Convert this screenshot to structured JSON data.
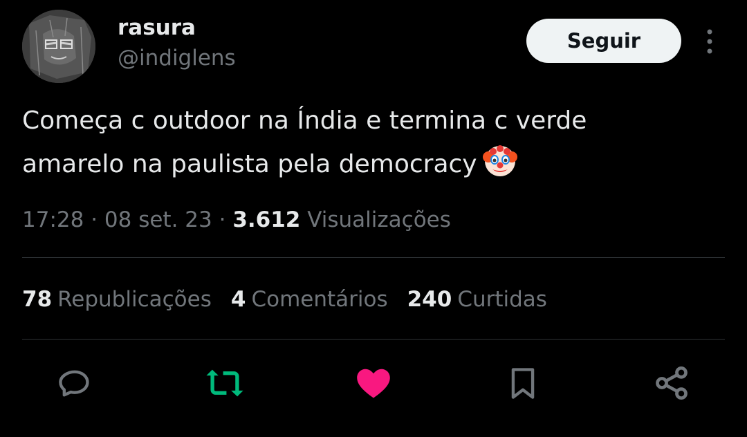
{
  "user": {
    "name": "rasura",
    "handle": "@indiglens",
    "follow_label": "Seguir"
  },
  "tweet": {
    "line1": "Começa c outdoor na Índia e termina c verde",
    "line2": "amarelo na paulista pela democracy",
    "emoji": "clown-face"
  },
  "meta": {
    "time": "17:28",
    "sep1": " · ",
    "date": "08 set. 23",
    "sep2": " · ",
    "views_count": "3.612",
    "views_label": " Visualizações"
  },
  "stats": [
    {
      "count": "78",
      "label": "Republicações"
    },
    {
      "count": "4",
      "label": "Comentários"
    },
    {
      "count": "240",
      "label": "Curtidas"
    }
  ],
  "actions": {
    "reply_icon": "speech-bubble-icon",
    "retweet_icon": "retweet-icon",
    "like_icon": "heart-icon",
    "bookmark_icon": "bookmark-icon",
    "share_icon": "share-icon"
  },
  "colors": {
    "background": "#000000",
    "text_primary": "#e7e9ea",
    "text_secondary": "#71767b",
    "retweet_active": "#00ba7c",
    "like_active": "#f91880",
    "follow_bg": "#eff3f4"
  }
}
